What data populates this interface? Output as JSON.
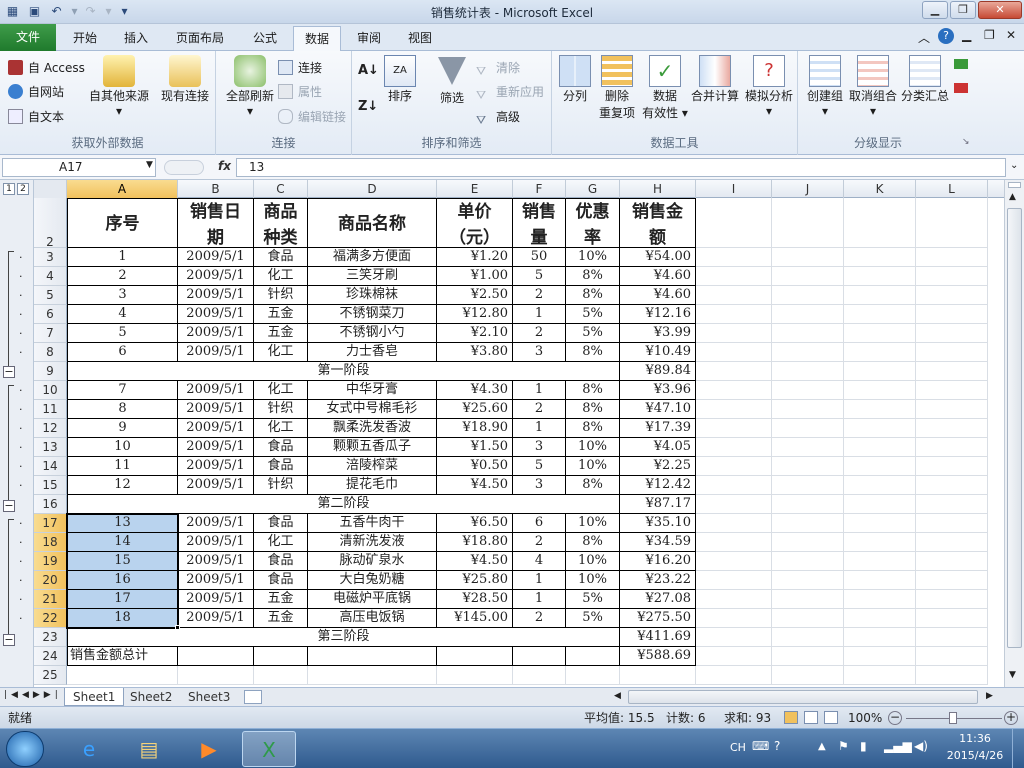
{
  "window": {
    "title": "销售统计表 - Microsoft Excel"
  },
  "tabs": {
    "file": "文件",
    "items": [
      "开始",
      "插入",
      "页面布局",
      "公式",
      "数据",
      "审阅",
      "视图"
    ]
  },
  "ribbon": {
    "ext": {
      "access": "自 Access",
      "web": "自网站",
      "text": "自文本",
      "other": "自其他来源",
      "existing": "现有连接",
      "label": "获取外部数据"
    },
    "conn": {
      "refresh": "全部刷新",
      "connections": "连接",
      "properties": "属性",
      "edit_links": "编辑链接",
      "label": "连接"
    },
    "sort": {
      "sort": "排序",
      "filter": "筛选",
      "clear": "清除",
      "reapply": "重新应用",
      "advanced": "高级",
      "label": "排序和筛选"
    },
    "tools": {
      "split": "分列",
      "dup1": "删除",
      "dup2": "重复项",
      "valid1": "数据",
      "valid2": "有效性",
      "consolidate": "合并计算",
      "whatif": "模拟分析",
      "label": "数据工具"
    },
    "outline": {
      "group": "创建组",
      "ungroup": "取消组合",
      "subtotal": "分类汇总",
      "label": "分级显示"
    }
  },
  "formula": {
    "namebox": "A17",
    "fx": "fx",
    "value": "13"
  },
  "columns": [
    "A",
    "B",
    "C",
    "D",
    "E",
    "F",
    "G",
    "H",
    "I",
    "J",
    "K",
    "L"
  ],
  "headers": {
    "a": "序号",
    "b1": "销售日",
    "b2": "期",
    "c1": "商品",
    "c2": "种类",
    "d": "商品名称",
    "e1": "单价",
    "e2": "（元）",
    "f1": "销售",
    "f2": "量",
    "g1": "优惠",
    "g2": "率",
    "h1": "销售金",
    "h2": "额"
  },
  "rows": [
    {
      "n": "3",
      "a": "1",
      "b": "2009/5/1",
      "c": "食品",
      "d": "福满多方便面",
      "e": "¥1.20",
      "f": "50",
      "g": "10%",
      "h": "¥54.00"
    },
    {
      "n": "4",
      "a": "2",
      "b": "2009/5/1",
      "c": "化工",
      "d": "三笑牙刷",
      "e": "¥1.00",
      "f": "5",
      "g": "8%",
      "h": "¥4.60"
    },
    {
      "n": "5",
      "a": "3",
      "b": "2009/5/1",
      "c": "针织",
      "d": "珍珠棉袜",
      "e": "¥2.50",
      "f": "2",
      "g": "8%",
      "h": "¥4.60"
    },
    {
      "n": "6",
      "a": "4",
      "b": "2009/5/1",
      "c": "五金",
      "d": "不锈钢菜刀",
      "e": "¥12.80",
      "f": "1",
      "g": "5%",
      "h": "¥12.16"
    },
    {
      "n": "7",
      "a": "5",
      "b": "2009/5/1",
      "c": "五金",
      "d": "不锈钢小勺",
      "e": "¥2.10",
      "f": "2",
      "g": "5%",
      "h": "¥3.99"
    },
    {
      "n": "8",
      "a": "6",
      "b": "2009/5/1",
      "c": "化工",
      "d": "力士香皂",
      "e": "¥3.80",
      "f": "3",
      "g": "8%",
      "h": "¥10.49"
    },
    {
      "n": "9",
      "sub": "第一阶段",
      "h": "¥89.84"
    },
    {
      "n": "10",
      "a": "7",
      "b": "2009/5/1",
      "c": "化工",
      "d": "中华牙膏",
      "e": "¥4.30",
      "f": "1",
      "g": "8%",
      "h": "¥3.96"
    },
    {
      "n": "11",
      "a": "8",
      "b": "2009/5/1",
      "c": "针织",
      "d": "女式中号棉毛衫",
      "e": "¥25.60",
      "f": "2",
      "g": "8%",
      "h": "¥47.10"
    },
    {
      "n": "12",
      "a": "9",
      "b": "2009/5/1",
      "c": "化工",
      "d": "飘柔洗发香波",
      "e": "¥18.90",
      "f": "1",
      "g": "8%",
      "h": "¥17.39"
    },
    {
      "n": "13",
      "a": "10",
      "b": "2009/5/1",
      "c": "食品",
      "d": "颗颗五香瓜子",
      "e": "¥1.50",
      "f": "3",
      "g": "10%",
      "h": "¥4.05"
    },
    {
      "n": "14",
      "a": "11",
      "b": "2009/5/1",
      "c": "食品",
      "d": "涪陵榨菜",
      "e": "¥0.50",
      "f": "5",
      "g": "10%",
      "h": "¥2.25"
    },
    {
      "n": "15",
      "a": "12",
      "b": "2009/5/1",
      "c": "针织",
      "d": "提花毛巾",
      "e": "¥4.50",
      "f": "3",
      "g": "8%",
      "h": "¥12.42"
    },
    {
      "n": "16",
      "sub": "第二阶段",
      "h": "¥87.17"
    },
    {
      "n": "17",
      "a": "13",
      "b": "2009/5/1",
      "c": "食品",
      "d": "五香牛肉干",
      "e": "¥6.50",
      "f": "6",
      "g": "10%",
      "h": "¥35.10"
    },
    {
      "n": "18",
      "a": "14",
      "b": "2009/5/1",
      "c": "化工",
      "d": "清新洗发液",
      "e": "¥18.80",
      "f": "2",
      "g": "8%",
      "h": "¥34.59"
    },
    {
      "n": "19",
      "a": "15",
      "b": "2009/5/1",
      "c": "食品",
      "d": "脉动矿泉水",
      "e": "¥4.50",
      "f": "4",
      "g": "10%",
      "h": "¥16.20"
    },
    {
      "n": "20",
      "a": "16",
      "b": "2009/5/1",
      "c": "食品",
      "d": "大白兔奶糖",
      "e": "¥25.80",
      "f": "1",
      "g": "10%",
      "h": "¥23.22"
    },
    {
      "n": "21",
      "a": "17",
      "b": "2009/5/1",
      "c": "五金",
      "d": "电磁炉平底锅",
      "e": "¥28.50",
      "f": "1",
      "g": "5%",
      "h": "¥27.08"
    },
    {
      "n": "22",
      "a": "18",
      "b": "2009/5/1",
      "c": "五金",
      "d": "高压电饭锅",
      "e": "¥145.00",
      "f": "2",
      "g": "5%",
      "h": "¥275.50"
    },
    {
      "n": "23",
      "sub": "第三阶段",
      "h": "¥411.69"
    },
    {
      "n": "24",
      "total": "销售金额总计",
      "h": "¥588.69"
    },
    {
      "n": "25",
      "empty": true
    }
  ],
  "selection": {
    "active": "A17",
    "range": [
      "17",
      "18",
      "19",
      "20",
      "21",
      "22"
    ]
  },
  "sheets": [
    "Sheet1",
    "Sheet2",
    "Sheet3"
  ],
  "status": {
    "ready": "就绪",
    "avg": "平均值: 15.5",
    "count": "计数: 6",
    "sum": "求和: 93",
    "zoom": "100%"
  },
  "taskbar": {
    "lang": "CH",
    "time": "11:36",
    "date": "2015/4/26"
  },
  "outline_levels": [
    "1",
    "2"
  ],
  "colors": {
    "accent": "#217346",
    "select": "#b9d3ee",
    "header_sel": "#f1c15d"
  }
}
